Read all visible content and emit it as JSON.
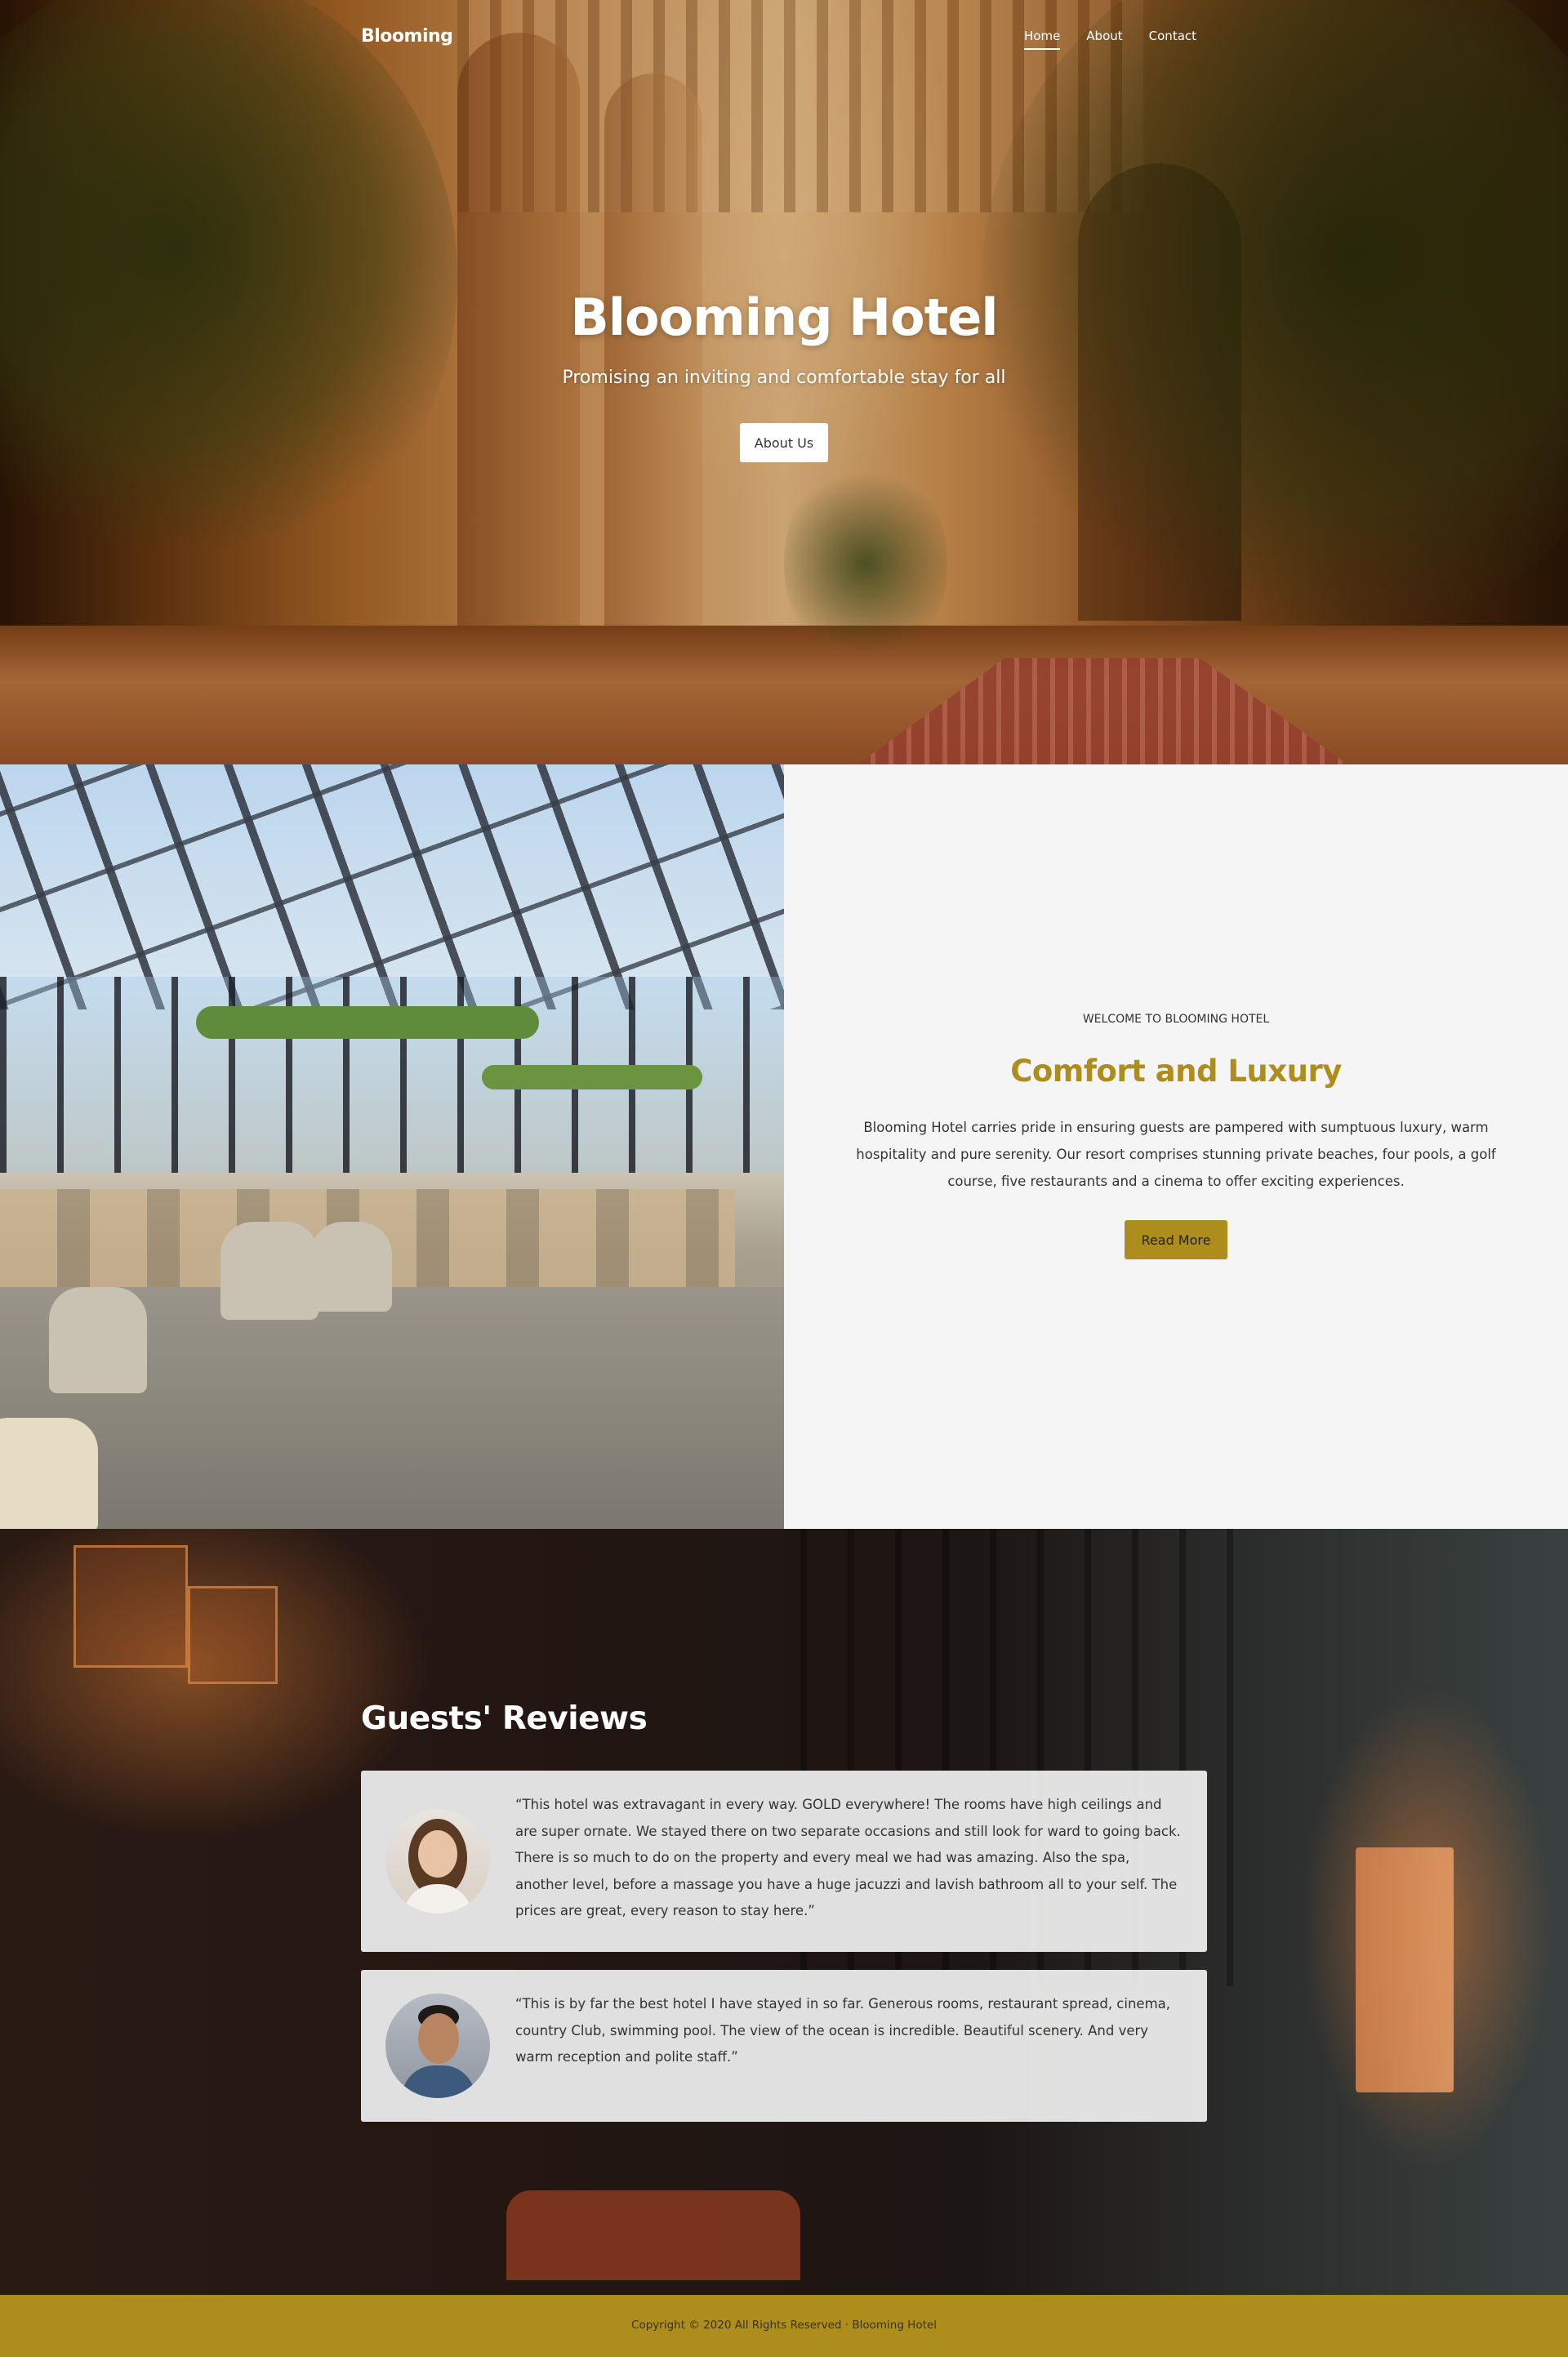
{
  "nav": {
    "brand": "Blooming",
    "links": [
      "Home",
      "About",
      "Contact"
    ],
    "active": "Home"
  },
  "hero": {
    "title": "Blooming Hotel",
    "subtitle": "Promising an inviting and comfortable stay for all",
    "button_label": "About Us"
  },
  "about": {
    "eyebrow": "WELCOME TO BLOOMING HOTEL",
    "title": "Comfort and Luxury",
    "body": "Blooming Hotel carries pride in ensuring guests are pampered with sumptuous luxury, warm hospitality and pure serenity. Our resort comprises stunning private beaches, four pools, a golf course, five restaurants and a cinema to offer exciting experiences.",
    "button_label": "Read More"
  },
  "reviews": {
    "title": "Guests' Reviews",
    "items": [
      {
        "quote": "“This hotel was extravagant in every way. GOLD everywhere! The rooms have high ceilings and are super ornate. We stayed there on two separate occasions and still look for ward to going back. There is so much to do on the property and every meal we had was amazing. Also the spa, another level, before a massage you have a huge jacuzzi and lavish bathroom all to your self. The prices are great, every reason to stay here.”",
        "avatar_icon": "guest-photo-woman"
      },
      {
        "quote": "“This is by far the best hotel I have stayed in so far. Generous rooms, restaurant spread, cinema, country Club, swimming pool. The view of the ocean is incredible. Beautiful scenery. And very warm reception and polite staff.”",
        "avatar_icon": "guest-photo-man"
      }
    ]
  },
  "footer": {
    "text": "Copyright © 2020 All Rights Reserved · Blooming Hotel"
  },
  "colors": {
    "accent": "#ad8d1c",
    "about_bg": "#f5f5f5",
    "card_bg": "#f0f0f0"
  }
}
